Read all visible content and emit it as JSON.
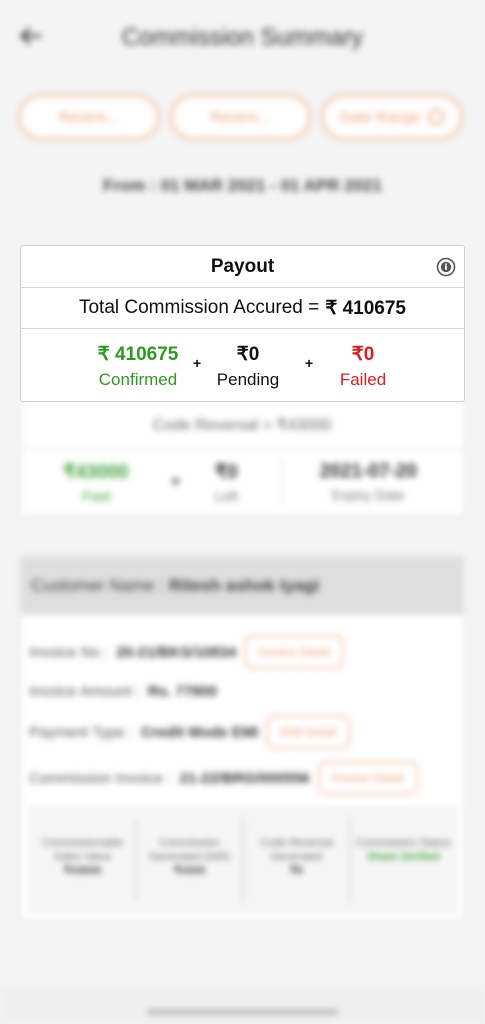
{
  "header": {
    "title": "Commission Summary"
  },
  "filters": {
    "btn1": "Revers...",
    "btn2": "Revers...",
    "btn3": "Date Range"
  },
  "date_range": "From : 01 MAR 2021 - 01 APR 2021",
  "payout": {
    "title": "Payout",
    "total_label": "Total Commission Accured =",
    "total_amount": "₹ 410675",
    "confirmed_value": "₹ 410675",
    "confirmed_label": "Confirmed",
    "pending_value": "₹0",
    "pending_label": "Pending",
    "failed_value": "₹0",
    "failed_label": "Failed",
    "plus": "+",
    "colors": {
      "confirmed": "#2e9a22",
      "failed": "#e01b1b"
    }
  },
  "code_reversal": {
    "title": "Code Reversal = ₹43000",
    "paid_value": "₹43000",
    "paid_label": "Paid",
    "plus": "+",
    "left_value": "₹0",
    "left_label": "Left",
    "expiry_value": "2021-07-20",
    "expiry_label": "Expiry Date"
  },
  "customer": {
    "name_label": "Customer Name :",
    "name_value": "Ritesh ashok tyagi",
    "invoice_no_label": "Invoice No :",
    "invoice_no_value": "20-21/BKS/10834",
    "invoice_detail_btn": "Invoice Detail",
    "invoice_amount_label": "Invoice Amount :",
    "invoice_amount_value": "Rs. 77800",
    "payment_type_label": "Payment Type :",
    "payment_type_value": "Credit Mode EMI",
    "emi_detail_btn": "EMI Detail",
    "commission_invoice_label": "Commission Invoice :",
    "commission_invoice_value": "21-22/BRG/000556",
    "commission_invoice_btn": "Invoice Detail",
    "stats": [
      {
        "label": "Commissionable Sales Value",
        "value": "₹43000"
      },
      {
        "label": "Commission Generated (INR)",
        "value": "₹4300"
      },
      {
        "label": "Code Reversal Generated",
        "value": "₹0"
      },
      {
        "label": "Commission Status",
        "value": "Sheet Verified"
      }
    ]
  },
  "icons": {
    "back": "arrow-left-icon",
    "info": "info-icon"
  }
}
